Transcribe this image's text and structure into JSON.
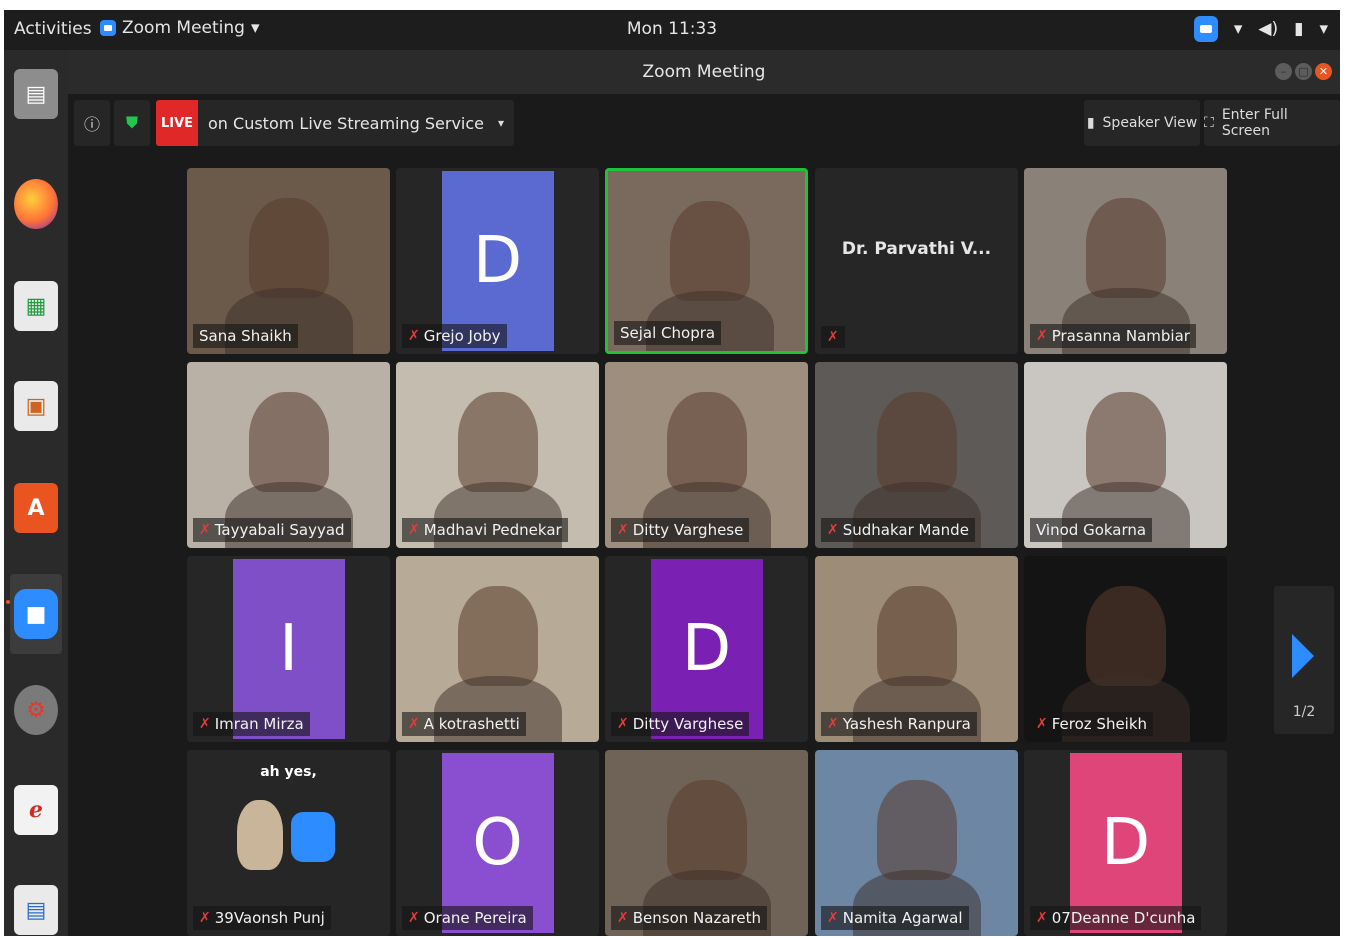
{
  "topbar": {
    "activities": "Activities",
    "app_menu": "Zoom Meeting",
    "app_menu_arrow": "▾",
    "clock": "Mon 11:33",
    "tray_icons": [
      "zoom-icon",
      "wifi-icon",
      "volume-icon",
      "battery-icon",
      "power-menu-icon"
    ]
  },
  "dock": {
    "items": [
      "files-icon",
      "firefox-icon",
      "calc-icon",
      "impress-icon",
      "software-center-icon",
      "zoom-icon",
      "settings-icon",
      "document-viewer-icon",
      "writer-icon"
    ]
  },
  "window": {
    "title": "Zoom Meeting"
  },
  "toolbar": {
    "live_badge": "LIVE",
    "live_text": "on Custom Live Streaming Service",
    "live_dropdown": "▾",
    "speaker_view": "Speaker View",
    "full_screen": "Enter Full Screen"
  },
  "participants": [
    {
      "name": "Sana Shaikh",
      "type": "video",
      "bg": "#6b5a4a",
      "muted": false
    },
    {
      "name": "Grejo Joby",
      "type": "avatar",
      "letter": "D",
      "color": "#5a6ad1",
      "muted": true
    },
    {
      "name": "Sejal Chopra",
      "type": "video",
      "bg": "#7a6a5e",
      "muted": false,
      "speaking": true
    },
    {
      "name": "Dr. Parvathi V...",
      "type": "text",
      "muted": true
    },
    {
      "name": "Prasanna Nambiar",
      "type": "video",
      "bg": "#8a8278",
      "muted": true
    },
    {
      "name": "Tayyabali Sayyad",
      "type": "video",
      "bg": "#b9b0a6",
      "muted": true
    },
    {
      "name": "Madhavi Pednekar",
      "type": "video",
      "bg": "#c4bcae",
      "muted": true
    },
    {
      "name": "Ditty Varghese",
      "type": "video",
      "bg": "#9e8e7e",
      "muted": true
    },
    {
      "name": "Sudhakar Mande",
      "type": "video",
      "bg": "#5e5a58",
      "muted": true
    },
    {
      "name": "Vinod Gokarna",
      "type": "video",
      "bg": "#c9c6c2",
      "muted": false
    },
    {
      "name": "Imran Mirza",
      "type": "avatar",
      "letter": "I",
      "color": "#7f4fc7",
      "muted": true
    },
    {
      "name": "A kotrashetti",
      "type": "video",
      "bg": "#b7aa96",
      "muted": true
    },
    {
      "name": "Ditty Varghese",
      "type": "avatar",
      "letter": "D",
      "color": "#7a21b3",
      "muted": true
    },
    {
      "name": "Yashesh Ranpura",
      "type": "video",
      "bg": "#9d8c78",
      "muted": true
    },
    {
      "name": "Feroz Sheikh",
      "type": "video",
      "bg": "#141414",
      "muted": true
    },
    {
      "name": "39Vaonsh Punj",
      "type": "image",
      "caption": "ah yes,",
      "muted": true
    },
    {
      "name": "Orane Pereira",
      "type": "avatar",
      "letter": "O",
      "color": "#8a4fd0",
      "muted": true
    },
    {
      "name": "Benson Nazareth",
      "type": "video",
      "bg": "#6f6256",
      "muted": true
    },
    {
      "name": "Namita Agarwal",
      "type": "video",
      "bg": "#6d86a3",
      "muted": true
    },
    {
      "name": "07Deanne D'cunha",
      "type": "avatar",
      "letter": "D",
      "color": "#e0457a",
      "muted": true
    }
  ],
  "pagination": {
    "indicator": "1/2"
  },
  "icons": {
    "mic_off": "🎙"
  }
}
